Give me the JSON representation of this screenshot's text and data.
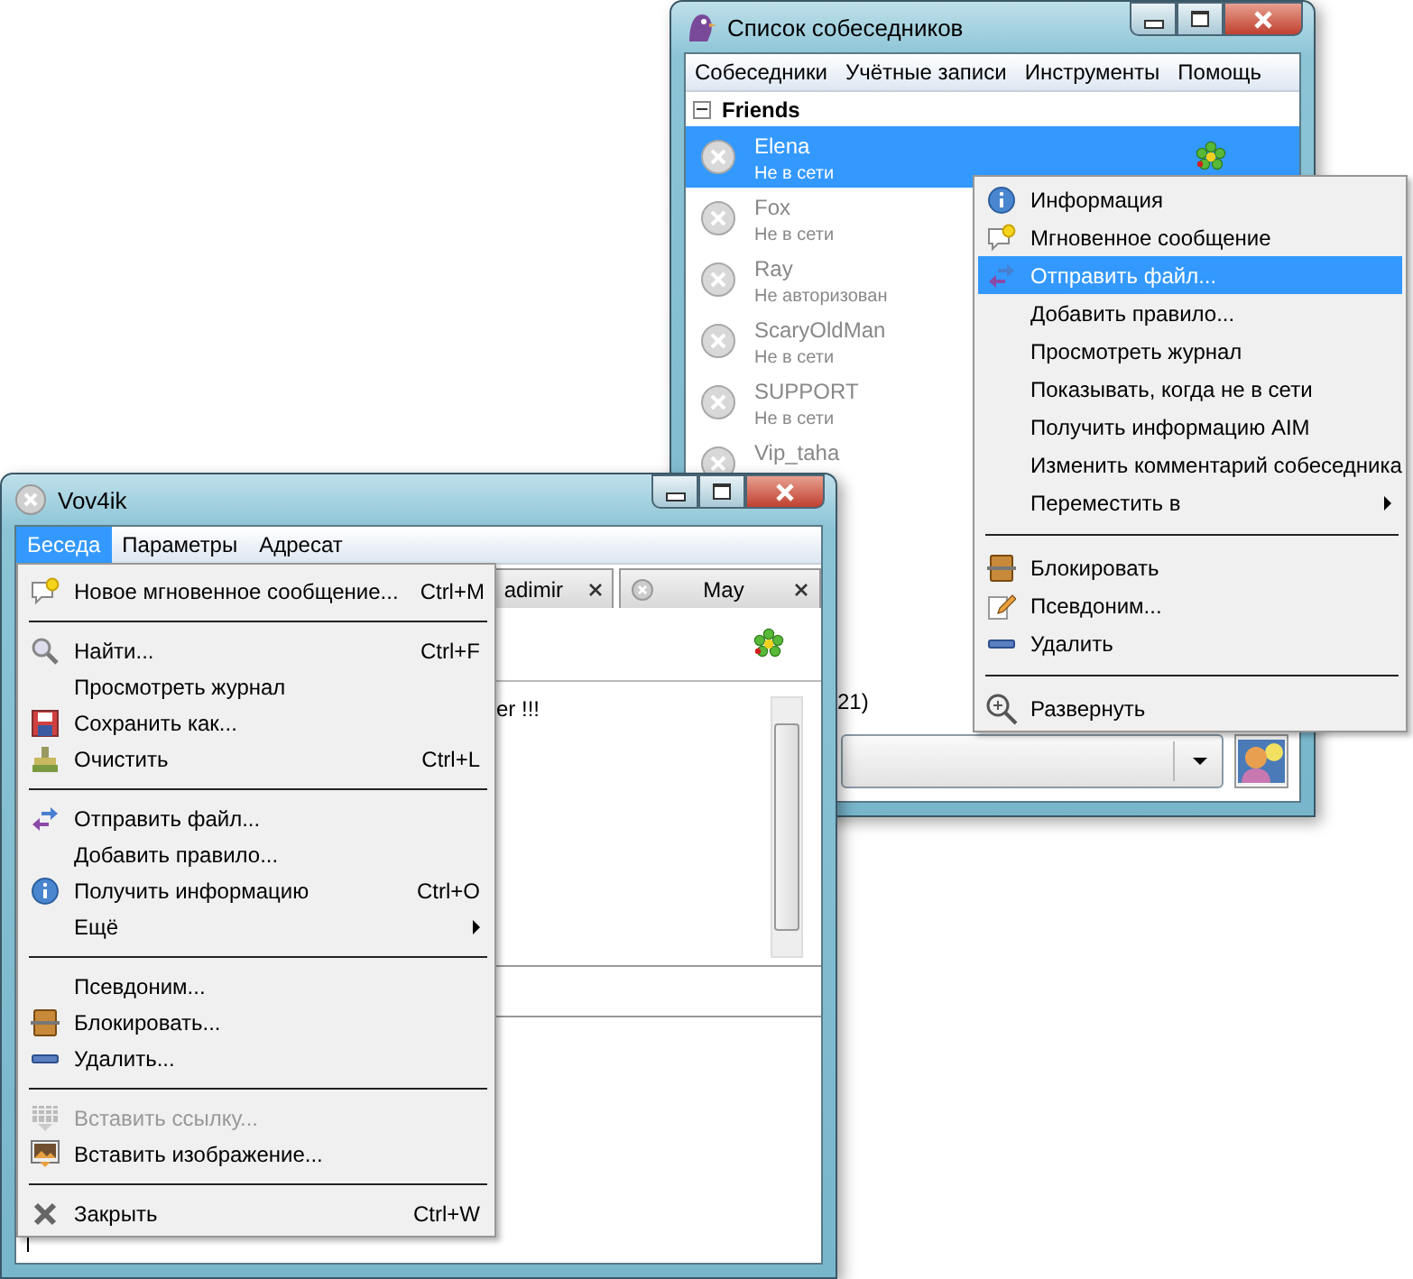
{
  "buddy_window": {
    "title": "Список собеседников",
    "menu": [
      {
        "label": "Собеседники"
      },
      {
        "label": "Учётные записи"
      },
      {
        "label": "Инструменты"
      },
      {
        "label": "Помощь"
      }
    ],
    "group": {
      "label": "Friends",
      "expanded": true
    },
    "contacts": [
      {
        "name": "Elena",
        "status": "Не в сети",
        "selected": true
      },
      {
        "name": "Fox",
        "status": "Не в сети",
        "selected": false
      },
      {
        "name": "Ray",
        "status": "Не авторизован",
        "selected": false
      },
      {
        "name": "ScaryOldMan",
        "status": "Не в сети",
        "selected": false
      },
      {
        "name": "SUPPORT",
        "status": "Не в сети",
        "selected": false
      },
      {
        "name": "Vip_taha",
        "selected": false
      }
    ],
    "status_fragment": "21)"
  },
  "context_menu": {
    "items": [
      {
        "kind": "item",
        "label": "Информация",
        "selected": false
      },
      {
        "kind": "item",
        "label": "Мгновенное сообщение",
        "selected": false
      },
      {
        "kind": "item",
        "label": "Отправить файл...",
        "selected": true
      },
      {
        "kind": "item",
        "label": "Добавить правило...",
        "selected": false
      },
      {
        "kind": "item",
        "label": "Просмотреть журнал",
        "selected": false
      },
      {
        "kind": "item",
        "label": "Показывать, когда не в сети",
        "selected": false
      },
      {
        "kind": "item",
        "label": "Получить информацию AIM",
        "selected": false
      },
      {
        "kind": "item",
        "label": "Изменить комментарий собеседника",
        "selected": false
      },
      {
        "kind": "item",
        "label": "Переместить в",
        "selected": false,
        "submenu": true
      },
      {
        "kind": "separator"
      },
      {
        "kind": "item",
        "label": "Блокировать",
        "selected": false
      },
      {
        "kind": "item",
        "label": "Псевдоним...",
        "selected": false
      },
      {
        "kind": "item",
        "label": "Удалить",
        "selected": false
      },
      {
        "kind": "separator"
      },
      {
        "kind": "item",
        "label": "Развернуть",
        "selected": false
      }
    ]
  },
  "chat_window": {
    "title": "Vov4ik",
    "menu": [
      {
        "label": "Беседа",
        "selected": true
      },
      {
        "label": "Параметры",
        "selected": false
      },
      {
        "label": "Адресат",
        "selected": false
      }
    ],
    "tabs": [
      {
        "label": "adimir"
      },
      {
        "label": "May"
      }
    ],
    "message_fragment": "er !!!"
  },
  "conversation_menu": {
    "items": [
      {
        "kind": "item",
        "label": "Новое мгновенное сообщение...",
        "shortcut": "Ctrl+M",
        "disabled": false
      },
      {
        "kind": "separator"
      },
      {
        "kind": "item",
        "label": "Найти...",
        "shortcut": "Ctrl+F",
        "disabled": false
      },
      {
        "kind": "item",
        "label": "Просмотреть журнал",
        "disabled": false
      },
      {
        "kind": "item",
        "label": "Сохранить как...",
        "disabled": false
      },
      {
        "kind": "item",
        "label": "Очистить",
        "shortcut": "Ctrl+L",
        "disabled": false
      },
      {
        "kind": "separator"
      },
      {
        "kind": "item",
        "label": "Отправить файл...",
        "disabled": false
      },
      {
        "kind": "item",
        "label": "Добавить правило...",
        "disabled": false
      },
      {
        "kind": "item",
        "label": "Получить информацию",
        "shortcut": "Ctrl+O",
        "disabled": false
      },
      {
        "kind": "item",
        "label": "Ещё",
        "disabled": false,
        "submenu": true
      },
      {
        "kind": "separator"
      },
      {
        "kind": "item",
        "label": "Псевдоним...",
        "disabled": false
      },
      {
        "kind": "item",
        "label": "Блокировать...",
        "disabled": false
      },
      {
        "kind": "item",
        "label": "Удалить...",
        "disabled": false
      },
      {
        "kind": "separator"
      },
      {
        "kind": "item",
        "label": "Вставить ссылку...",
        "disabled": true
      },
      {
        "kind": "item",
        "label": "Вставить изображение...",
        "disabled": false
      },
      {
        "kind": "separator"
      },
      {
        "kind": "item",
        "label": "Закрыть",
        "shortcut": "Ctrl+W",
        "disabled": false
      }
    ]
  }
}
